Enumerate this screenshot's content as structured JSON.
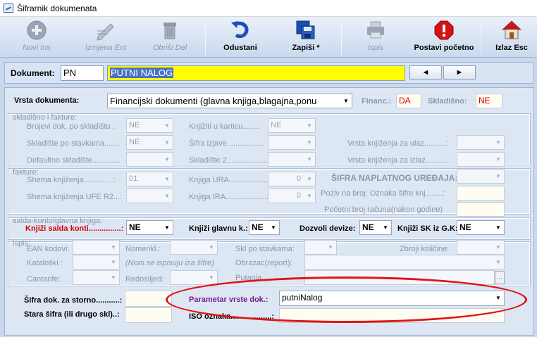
{
  "window": {
    "title": "Šifrarnik dokumenata"
  },
  "toolbar": [
    {
      "label": "Novi Ins",
      "icon": "plus-circle-icon",
      "enabled": false
    },
    {
      "label": "Izmjena Ent",
      "icon": "edit-pen-icon",
      "enabled": false
    },
    {
      "label": "Obriši Del",
      "icon": "trash-icon",
      "enabled": false
    },
    {
      "label": "Odustani",
      "icon": "undo-arrow-icon",
      "enabled": true
    },
    {
      "label": "Zapiši *",
      "icon": "floppy-disk-icon",
      "enabled": true
    },
    {
      "label": "Ispis",
      "icon": "printer-icon",
      "enabled": false
    },
    {
      "label": "Postavi početno",
      "icon": "stop-sign-icon",
      "enabled": true
    },
    {
      "label": "Izlaz Esc",
      "icon": "home-exit-icon",
      "enabled": true
    }
  ],
  "document": {
    "label": "Dokument:",
    "code": "PN",
    "name": "PUTNI NALOG",
    "prev": "◄",
    "next": "►"
  },
  "vrsta": {
    "label": "Vrsta dokumenta:",
    "value": "Financijski dokumenti (glavna knjiga,blagajna,ponu",
    "financ_label": "Financ.:",
    "financ_value": "DA",
    "skladisno_label": "Skladišno:",
    "skladisno_value": "NE"
  },
  "skladisno": {
    "group_title": "skladišno i fakture:",
    "brojevi_label": "Brojevi dok. po skladištu :",
    "brojevi_value": "NE",
    "skladiste_stavkama_label": "Skladište po stavkama......:",
    "skladiste_stavkama_value": "NE",
    "defaultno_label": "Defaultno skladište.............",
    "knjiziti_label": "Knjižiti u karticu.......:",
    "knjiziti_value": "NE",
    "sifra_izjave_label": "Šifra izjave.................",
    "skladiste2_label": "Skladište 2.....................",
    "vrsta_ulaz_label": "Vrsta knjiženja za ulaz..........:",
    "vrsta_izlaz_label": "Vrsta knjiženja za izlaz..........:"
  },
  "fakture": {
    "group_title": "fakture:",
    "shema_label": "Shema knjiženja..............:",
    "shema_value": "01",
    "shema_ufe_label": "Shema knjiženja UFE R2...:",
    "knjiga_ura_label": "Knjiga URA.......................",
    "knjiga_ura_value": "0",
    "knjiga_ira_label": "Knjiga IRA.........................",
    "knjiga_ira_value": "0",
    "sifra_naplatnog_label": "ŠIFRA NAPLATNOG UREĐAJA:",
    "poziv_label": "Poziv na broj: Oznaka šifre knj........:",
    "pocetni_label": "Početni broj računa(nakon godine)"
  },
  "salda": {
    "group_title": "salda-konto/glavna knjiga:",
    "knjizi_salda_label": "Knjiži salda konti...............:",
    "knjizi_salda_value": "NE",
    "knjizi_glavnu_label": "Knjiži glavnu k.:",
    "knjizi_glavnu_value": "NE",
    "dozvoli_devize_label": "Dozvoli devize:",
    "dozvoli_devize_value": "NE",
    "knjizi_sk_label": "Knjiži SK iz G.K:",
    "knjizi_sk_value": "NE"
  },
  "ispis": {
    "group_title": "ispis:",
    "ean_label": "EAN kodovi:",
    "nomenkl_label": "Nomenkl.:",
    "skl_stavkama_label": "Skl po stavkama:",
    "zbroji_label": "Zbroji količine:",
    "katalo_label": "Kataloški :",
    "nom_note": "(Nom.se ispisuju iza šifre)",
    "obrazac_label": "Obrazac(report):",
    "cantarife_label": "Cantarife:",
    "redoslijed_label": "Redoslijed:",
    "putanja_label": "Putanja......:",
    "dots": "..."
  },
  "bottom": {
    "sifra_storno_label": "Šifra dok. za storno...........:",
    "stara_sifra_label": "Stara šifra (ili drugo skl)..:",
    "parametar_label": "Parametar vrste dok.:",
    "parametar_value": "putniNalog",
    "iso_label": "ISO oznaka...................:"
  }
}
